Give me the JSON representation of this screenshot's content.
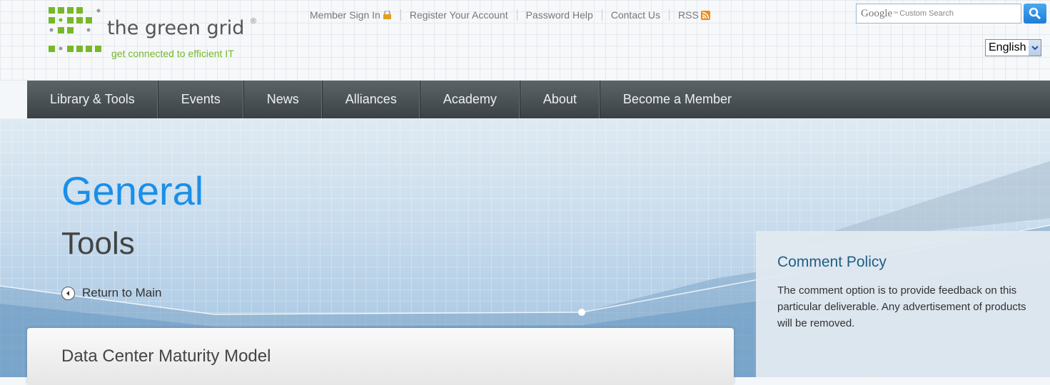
{
  "logo": {
    "name": "the green grid",
    "tagline": "get connected to efficient IT"
  },
  "utility": {
    "links": [
      "Member Sign In",
      "Register Your Account",
      "Password Help",
      "Contact Us",
      "RSS"
    ]
  },
  "search": {
    "brand": "Google",
    "placeholder": "Custom Search"
  },
  "language": {
    "selected": "English"
  },
  "nav": {
    "items": [
      "Library & Tools",
      "Events",
      "News",
      "Alliances",
      "Academy",
      "About",
      "Become a Member"
    ]
  },
  "hero": {
    "title": "General",
    "subtitle": "Tools",
    "back_label": "Return to Main"
  },
  "panel": {
    "title": "Data Center Maturity Model"
  },
  "comment": {
    "title": "Comment Policy",
    "text": "The comment option is to provide feedback on this particular deliverable. Any advertisement of products will be removed."
  },
  "colors": {
    "accent_blue": "#1a8fe8",
    "logo_green": "#77b82a",
    "nav_dark": "#43494c"
  }
}
